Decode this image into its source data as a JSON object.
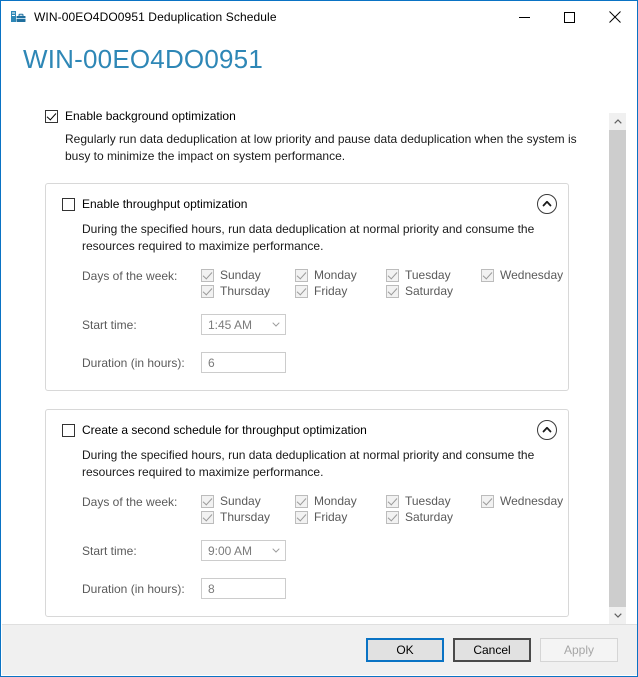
{
  "window": {
    "title": "WIN-00EO4DO0951 Deduplication Schedule",
    "icon": "dedup-server-icon",
    "minimize_label": "Minimize",
    "maximize_label": "Maximize",
    "close_label": "Close",
    "accent_color": "#0a73c4"
  },
  "header": {
    "title": "WIN-00EO4DO0951",
    "color": "#2e87b6"
  },
  "background_optimization": {
    "checkbox_label": "Enable background optimization",
    "checked": true,
    "description": "Regularly run data deduplication at low priority and pause data deduplication when the system is busy to minimize the impact on system performance."
  },
  "panels": [
    {
      "checkbox_label": "Enable throughput optimization",
      "checked": false,
      "collapse_icon": "chevron-up-circle-icon",
      "description": "During the specified hours, run data deduplication at normal priority and consume the resources required to maximize performance.",
      "days_label": "Days of the week:",
      "days": [
        {
          "label": "Sunday",
          "checked": true
        },
        {
          "label": "Monday",
          "checked": true
        },
        {
          "label": "Tuesday",
          "checked": true
        },
        {
          "label": "Wednesday",
          "checked": true
        },
        {
          "label": "Thursday",
          "checked": true
        },
        {
          "label": "Friday",
          "checked": true
        },
        {
          "label": "Saturday",
          "checked": true
        }
      ],
      "start_time_label": "Start time:",
      "start_time_value": "1:45 AM",
      "duration_label": "Duration (in hours):",
      "duration_value": "6"
    },
    {
      "checkbox_label": "Create a second schedule for throughput optimization",
      "checked": false,
      "collapse_icon": "chevron-up-circle-icon",
      "description": "During the specified hours, run data deduplication at normal priority and consume the resources required to maximize performance.",
      "days_label": "Days of the week:",
      "days": [
        {
          "label": "Sunday",
          "checked": true
        },
        {
          "label": "Monday",
          "checked": true
        },
        {
          "label": "Tuesday",
          "checked": true
        },
        {
          "label": "Wednesday",
          "checked": true
        },
        {
          "label": "Thursday",
          "checked": true
        },
        {
          "label": "Friday",
          "checked": true
        },
        {
          "label": "Saturday",
          "checked": true
        }
      ],
      "start_time_label": "Start time:",
      "start_time_value": "9:00 AM",
      "duration_label": "Duration (in hours):",
      "duration_value": "8"
    }
  ],
  "scrollbar": {
    "up_icon": "chevron-up-icon",
    "down_icon": "chevron-down-icon"
  },
  "buttons": {
    "ok": "OK",
    "cancel": "Cancel",
    "apply": "Apply",
    "apply_disabled": true
  }
}
